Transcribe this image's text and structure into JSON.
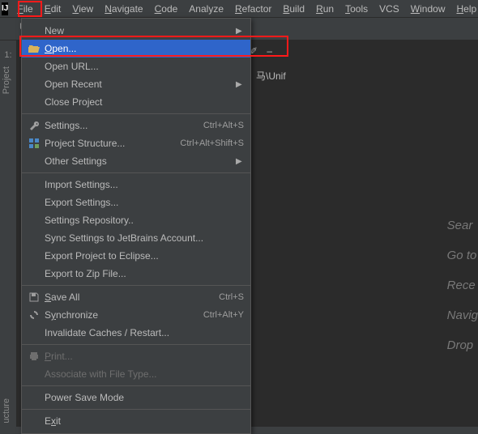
{
  "menubar": {
    "items": [
      {
        "label": "File",
        "u": "F",
        "rest": "ile"
      },
      {
        "label": "Edit",
        "u": "E",
        "rest": "dit"
      },
      {
        "label": "View",
        "u": "V",
        "rest": "iew"
      },
      {
        "label": "Navigate",
        "u": "N",
        "rest": "avigate"
      },
      {
        "label": "Code",
        "u": "C",
        "rest": "ode"
      },
      {
        "label": "Analyze",
        "u": null,
        "rest": "Analyze"
      },
      {
        "label": "Refactor",
        "u": "R",
        "rest": "efactor"
      },
      {
        "label": "Build",
        "u": "B",
        "rest": "uild"
      },
      {
        "label": "Run",
        "u": "R",
        "rest": "un"
      },
      {
        "label": "Tools",
        "u": "T",
        "rest": "ools"
      },
      {
        "label": "VCS",
        "u": null,
        "rest": "VCS"
      },
      {
        "label": "Window",
        "u": "W",
        "rest": "indow"
      },
      {
        "label": "Help",
        "u": "H",
        "rest": "elp"
      }
    ]
  },
  "side": {
    "project_num": "1:",
    "project": "Project",
    "structure": "ucture"
  },
  "breadcrumb": "U",
  "path_fragment": "马\\Unif",
  "toolbar_right": {
    "a": "✐",
    "b": "–"
  },
  "welcome": {
    "l1": "Sear",
    "l2": "Go to",
    "l3": "Rece",
    "l4": "Navig",
    "l5": "Drop"
  },
  "menu": {
    "new": "New",
    "open": "Open...",
    "open_url": "Open URL...",
    "open_recent": "Open Recent",
    "close_project": "Close Project",
    "settings": "Settings...",
    "settings_sc": "Ctrl+Alt+S",
    "proj_struct": "Project Structure...",
    "proj_struct_sc": "Ctrl+Alt+Shift+S",
    "other_settings": "Other Settings",
    "import_settings": "Import Settings...",
    "export_settings": "Export Settings...",
    "settings_repo": "Settings Repository..",
    "sync": "Sync Settings to JetBrains Account...",
    "export_eclipse": "Export Project to Eclipse...",
    "export_zip": "Export to Zip File...",
    "save_all": "Save All",
    "save_all_sc": "Ctrl+S",
    "synchronize": "Synchronize",
    "synchronize_sc": "Ctrl+Alt+Y",
    "invalidate": "Invalidate Caches / Restart...",
    "print": "Print...",
    "assoc": "Associate with File Type...",
    "power": "Power Save Mode",
    "exit": "Exit"
  },
  "underline": {
    "open": "O",
    "save": "S",
    "sync": "y",
    "print": "P",
    "exit": "x"
  }
}
